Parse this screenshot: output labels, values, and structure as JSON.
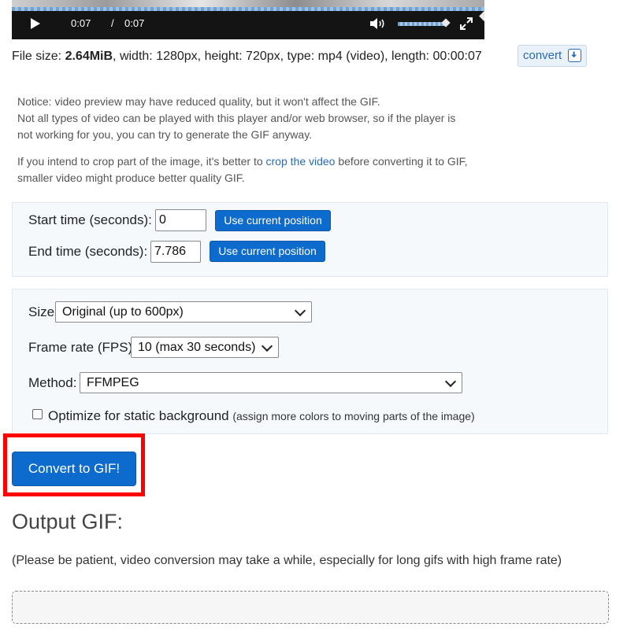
{
  "player": {
    "current_time": "0:07",
    "separator": "/",
    "duration": "0:07",
    "progress_fraction": 1.0,
    "volume_fraction": 0.95
  },
  "file_info": {
    "prefix": "File size: ",
    "size": "2.64MiB",
    "details": ", width: 1280px, height: 720px, type: mp4 (video), length: 00:00:07",
    "convert_label": "convert"
  },
  "notice": {
    "line1": "Notice: video preview may have reduced quality, but it won't affect the GIF.",
    "line2": "Not all types of video can be played with this player and/or web browser, so if the player is",
    "line3": "not working for you, you can try to generate the GIF anyway.",
    "crop_pre": "If you intend to crop part of the image, it's better to ",
    "crop_link": "crop the video",
    "crop_post": " before converting it to GIF,",
    "crop_line2": "smaller video might produce better quality GIF."
  },
  "time_panel": {
    "start_label": "Start time (seconds):",
    "start_value": "0",
    "end_label": "End time (seconds):",
    "end_value": "7.786",
    "use_current_label": "Use current position"
  },
  "options_panel": {
    "size_label": "Size:",
    "size_value": "Original (up to 600px)",
    "fps_label": "Frame rate (FPS):",
    "fps_value": "10 (max 30 seconds)",
    "method_label": "Method:",
    "method_value": "FFMPEG",
    "optimize_label": "Optimize for static background",
    "optimize_note": "(assign more colors to moving parts of the image)",
    "optimize_checked": false
  },
  "convert_button": "Convert to GIF!",
  "output": {
    "title": "Output GIF:",
    "patience_note": "(Please be patient, video conversion may take a while, especially for long gifs with high frame rate)"
  },
  "colors": {
    "primary_button": "#0d6bcd",
    "highlight_frame": "#ff0000",
    "link": "#2a6ab3"
  }
}
